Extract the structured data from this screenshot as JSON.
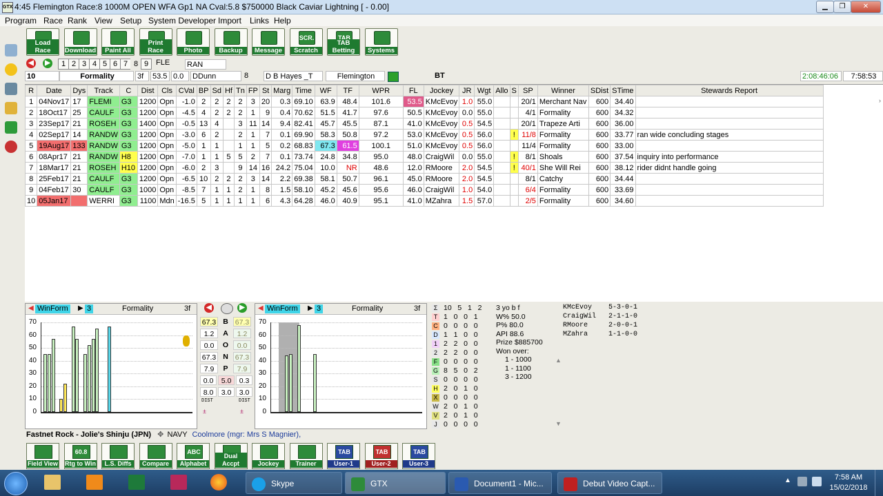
{
  "window": {
    "title": "4:45 Flemington Race:8 1000M   OPEN WFA Gp1  NA Cval:5.8 $750000 Black Caviar Lightning [ - 0.00]",
    "icon": "GTX"
  },
  "menu": [
    "Program",
    "Race",
    "Rank",
    "View",
    "Setup",
    "System Developer",
    "Import",
    "Links",
    "Help"
  ],
  "toolbar": [
    {
      "label": "Load Race",
      "icon": "load-race-icon"
    },
    {
      "label": "Download",
      "icon": "download-icon"
    },
    {
      "label": "Paint All",
      "icon": "paint-all-icon"
    },
    {
      "label": "Print Race",
      "icon": "print-race-icon"
    },
    {
      "label": "Photo",
      "icon": "camera-icon"
    },
    {
      "label": "Backup",
      "icon": "backup-icon"
    },
    {
      "label": "Message",
      "icon": "message-icon"
    },
    {
      "label": "Scratch",
      "icon": "scratch-icon",
      "glyph": "SCR."
    },
    {
      "label": "TAB Betting",
      "icon": "tab-icon",
      "glyph": "TAB"
    },
    {
      "label": "Systems",
      "icon": "systems-icon"
    }
  ],
  "nav": {
    "tabs": [
      "1",
      "2",
      "3",
      "4",
      "5",
      "6",
      "7",
      "8",
      "9"
    ],
    "selected": "8",
    "track": "FLE",
    "status": "RAN"
  },
  "info": {
    "num": "10",
    "horse": "Formality",
    "dist": "3f",
    "rating": "53.5",
    "val": "0.0",
    "jockey": "DDunn",
    "barrier": "8",
    "trainer": "D  B Hayes _T",
    "track": "Flemington",
    "flag": "BT",
    "clock1": "2:08:46:06",
    "clock2": "7:58:53"
  },
  "table": {
    "headers": [
      "R",
      "Date",
      "Dys",
      "Track",
      "C",
      "Dist",
      "Cls",
      "CVal",
      "BP",
      "Sd",
      "Hf",
      "Tn",
      "FP",
      "St",
      "Marg",
      "Time",
      "WF",
      "TF",
      "WPR",
      "FL",
      "Jockey",
      "JR",
      "Wgt",
      "Allo",
      "S",
      "SP",
      "Winner",
      "SDist",
      "STime",
      "Stewards Report"
    ],
    "rows": [
      [
        "1",
        "04Nov17",
        "17",
        "FLEMI",
        "G3",
        "1200",
        "Opn",
        "-1.0",
        "2",
        "2",
        "2",
        "2",
        "3",
        "20",
        "0.3",
        "69.10",
        "63.9",
        "48.4",
        "101.6",
        "53.5",
        "KMcEvoy",
        "1.0",
        "55.0",
        "",
        "",
        "20/1",
        "Merchant Nav",
        "600",
        "34.40",
        ""
      ],
      [
        "2",
        "18Oct17",
        "25",
        "CAULF",
        "G3",
        "1200",
        "Opn",
        "-4.5",
        "4",
        "2",
        "2",
        "2",
        "1",
        "9",
        "0.4",
        "70.62",
        "51.5",
        "41.7",
        "97.6",
        "50.5",
        "KMcEvoy",
        "0.0",
        "55.0",
        "",
        "",
        "4/1",
        "Formality",
        "600",
        "34.32",
        ""
      ],
      [
        "3",
        "23Sep17",
        "21",
        "ROSEH",
        "G3",
        "1400",
        "Opn",
        "-0.5",
        "13",
        "4",
        "",
        "3",
        "11",
        "14",
        "9.4",
        "82.41",
        "45.7",
        "45.5",
        "87.1",
        "41.0",
        "KMcEvoy",
        "0.5",
        "54.5",
        "",
        "",
        "20/1",
        "Trapeze Arti",
        "600",
        "36.00",
        ""
      ],
      [
        "4",
        "02Sep17",
        "14",
        "RANDW",
        "G3",
        "1200",
        "Opn",
        "-3.0",
        "6",
        "2",
        "",
        "2",
        "1",
        "7",
        "0.1",
        "69.90",
        "58.3",
        "50.8",
        "97.2",
        "53.0",
        "KMcEvoy",
        "0.5",
        "56.0",
        "",
        "!",
        "11/8",
        "Formality",
        "600",
        "33.77",
        "ran wide  concluding stages"
      ],
      [
        "5",
        "19Aug17",
        "133",
        "RANDW",
        "G3",
        "1200",
        "Opn",
        "-5.0",
        "1",
        "1",
        "",
        "1",
        "1",
        "5",
        "0.2",
        "68.83",
        "67.3",
        "61.5",
        "100.1",
        "51.0",
        "KMcEvoy",
        "0.5",
        "56.0",
        "",
        "",
        "11/4",
        "Formality",
        "600",
        "33.00",
        ""
      ],
      [
        "6",
        "08Apr17",
        "21",
        "RANDW",
        "H8",
        "1200",
        "Opn",
        "-7.0",
        "1",
        "1",
        "5",
        "5",
        "2",
        "7",
        "0.1",
        "73.74",
        "24.8",
        "34.8",
        "95.0",
        "48.0",
        "CraigWil",
        "0.0",
        "55.0",
        "",
        "!",
        "8/1",
        "Shoals",
        "600",
        "37.54",
        "inquiry into performance"
      ],
      [
        "7",
        "18Mar17",
        "21",
        "ROSEH",
        "H10",
        "1200",
        "Opn",
        "-6.0",
        "2",
        "3",
        "",
        "9",
        "14",
        "16",
        "24.2",
        "75.04",
        "10.0",
        "NR",
        "48.6",
        "12.0",
        "RMoore",
        "2.0",
        "54.5",
        "",
        "!",
        "40/1",
        "She Will Rei",
        "600",
        "38.12",
        "rider didnt handle going"
      ],
      [
        "8",
        "25Feb17",
        "21",
        "CAULF",
        "G3",
        "1200",
        "Opn",
        "-6.5",
        "10",
        "2",
        "2",
        "2",
        "3",
        "14",
        "2.2",
        "69.38",
        "58.1",
        "50.7",
        "96.1",
        "45.0",
        "RMoore",
        "2.0",
        "54.5",
        "",
        "",
        "8/1",
        "Catchy",
        "600",
        "34.44",
        ""
      ],
      [
        "9",
        "04Feb17",
        "30",
        "CAULF",
        "G3",
        "1000",
        "Opn",
        "-8.5",
        "7",
        "1",
        "1",
        "2",
        "1",
        "8",
        "1.5",
        "58.10",
        "45.2",
        "45.6",
        "95.6",
        "46.0",
        "CraigWil",
        "1.0",
        "54.0",
        "",
        "",
        "6/4",
        "Formality",
        "600",
        "33.69",
        ""
      ],
      [
        "10",
        "05Jan17",
        "",
        "WERRI",
        "G3",
        "1100",
        "Mdn",
        "-16.5",
        "5",
        "1",
        "1",
        "1",
        "1",
        "6",
        "4.3",
        "64.28",
        "46.0",
        "40.9",
        "95.1",
        "41.0",
        "MZahra",
        "1.5",
        "57.0",
        "",
        "",
        "2/5",
        "Formality",
        "600",
        "34.60",
        ""
      ]
    ]
  },
  "panel_left": {
    "tab": "WinForm",
    "count": "3",
    "horse": "Formality",
    "dist": "3f"
  },
  "panel_right": {
    "tab": "WinForm",
    "count": "3",
    "horse": "Formality",
    "dist": "3f"
  },
  "chart_data": [
    {
      "type": "bar",
      "title": "",
      "ylim": [
        0,
        70
      ],
      "yticks": [
        "70",
        "60",
        "50",
        "40",
        "30",
        "20",
        "10",
        "0"
      ],
      "series": [
        {
          "values": [
            45,
            45,
            57,
            0,
            10,
            22,
            0,
            67,
            57,
            0,
            45,
            52,
            57,
            65,
            0,
            0,
            67
          ]
        }
      ]
    },
    {
      "type": "bar",
      "title": "",
      "ylim": [
        0,
        70
      ],
      "yticks": [
        "70",
        "60",
        "50",
        "40",
        "30",
        "20",
        "10",
        "0"
      ],
      "series": [
        {
          "values": [
            0,
            0,
            0,
            44,
            45,
            0,
            68,
            0,
            0,
            0,
            45
          ]
        }
      ]
    }
  ],
  "mid": {
    "rows": [
      {
        "a": "67.3",
        "label": "B",
        "b": "67.3"
      },
      {
        "a": "1.2",
        "label": "A",
        "b": "1.2"
      },
      {
        "a": "0.0",
        "label": "O",
        "b": "0.0"
      },
      {
        "a": "67.3",
        "label": "N",
        "b": "67.3"
      },
      {
        "a": "7.9",
        "label": "P",
        "b": "7.9"
      }
    ],
    "extra": [
      [
        "0.0",
        "5.0",
        "0.3"
      ],
      [
        "8.0",
        "3.0",
        "3.0"
      ]
    ],
    "foot_left": "DIST",
    "foot_right": "DIST"
  },
  "stats": [
    {
      "k": "Σ",
      "v": "10   5   1   2"
    },
    {
      "k": "T",
      "v": "1   0   0   1"
    },
    {
      "k": "C",
      "v": "0   0   0   0"
    },
    {
      "k": "D",
      "v": "1   1   0   0"
    },
    {
      "k": "1",
      "v": "2   2   0   0"
    },
    {
      "k": "2",
      "v": "2   2   0   0"
    },
    {
      "k": "F",
      "v": "0   0   0   0"
    },
    {
      "k": "G",
      "v": "8   5   0   2"
    },
    {
      "k": "S",
      "v": "0   0   0   0"
    },
    {
      "k": "H",
      "v": "2   0   1   0"
    },
    {
      "k": "X",
      "v": "0   0   0   0"
    },
    {
      "k": "W",
      "v": "2   0   1   0"
    },
    {
      "k": "V",
      "v": "2   0   1   0"
    },
    {
      "k": "J",
      "v": "0   0   0   0"
    }
  ],
  "horse_info": [
    "3 yo b f",
    "W% 50.0",
    "P% 80.0",
    "API 88.6",
    "Prize $885700",
    "Won over:",
    "1 - 1000",
    "1 - 1100",
    "3 - 1200"
  ],
  "jockey_stats": [
    [
      "KMcEvoy",
      "5-3-0-1"
    ],
    [
      "CraigWil",
      "2-1-1-0"
    ],
    [
      "RMoore",
      "2-0-0-1"
    ],
    [
      "MZahra",
      "1-1-0-0"
    ]
  ],
  "breeding": {
    "sire": "Fastnet Rock - Jolie's Shinju (JPN)",
    "colour": "NAVY",
    "owner": "Coolmore (mgr: Mrs S Magnier),"
  },
  "bottom_toolbar": [
    {
      "label": "Field View"
    },
    {
      "label": "Rtg to Win",
      "glyph": "60.8"
    },
    {
      "label": "L.S. Diffs"
    },
    {
      "label": "Compare"
    },
    {
      "label": "Alphabet",
      "glyph": "ABC"
    },
    {
      "label": "Dual Accpt"
    },
    {
      "label": "Jockey"
    },
    {
      "label": "Trainer"
    },
    {
      "label": "User-1",
      "glyph": "TAB"
    },
    {
      "label": "User-2",
      "glyph": "TAB"
    },
    {
      "label": "User-3",
      "glyph": "TAB"
    }
  ],
  "taskbar": {
    "items": [
      "Skype",
      "GTX",
      "Document1 - Mic...",
      "Debut Video Capt..."
    ],
    "time": "7:58 AM",
    "date": "15/02/2018"
  }
}
